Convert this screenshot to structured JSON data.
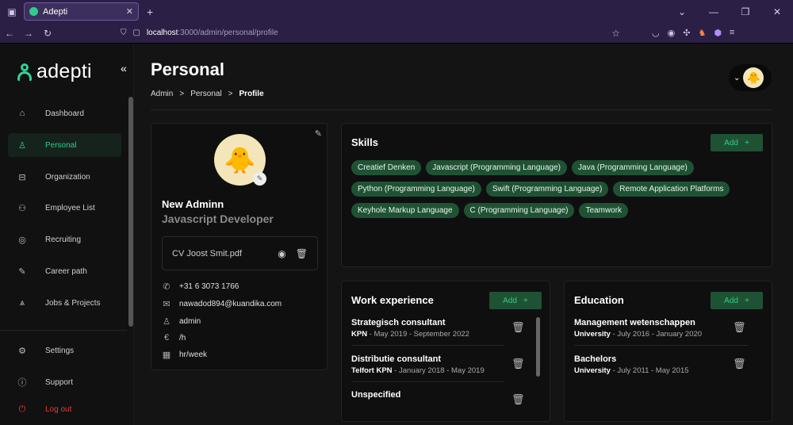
{
  "browser": {
    "tab_title": "Adepti",
    "url_host": "localhost",
    "url_path": ":3000/admin/personal/profile"
  },
  "sidebar": {
    "logo_text": "adepti",
    "items": [
      {
        "label": "Dashboard",
        "icon": "home-icon"
      },
      {
        "label": "Personal",
        "icon": "user-icon"
      },
      {
        "label": "Organization",
        "icon": "briefcase-icon"
      },
      {
        "label": "Employee List",
        "icon": "users-icon"
      },
      {
        "label": "Recruiting",
        "icon": "eye-icon"
      },
      {
        "label": "Career path",
        "icon": "pen-icon"
      },
      {
        "label": "Jobs & Projects",
        "icon": "stack-icon"
      }
    ],
    "bottom_items": [
      {
        "label": "Settings",
        "icon": "gear-icon"
      },
      {
        "label": "Support",
        "icon": "info-icon"
      },
      {
        "label": "Log out",
        "icon": "power-icon"
      }
    ]
  },
  "header": {
    "title": "Personal",
    "breadcrumb": [
      "Admin",
      "Personal",
      "Profile"
    ]
  },
  "profile": {
    "name": "New Adminn",
    "role": "Javascript Developer",
    "cv_file": "CV Joost Smit.pdf",
    "phone": "+31 6 3073 1766",
    "email": "nawadod894@kuandika.com",
    "username": "admin",
    "rate": "/h",
    "hours": "hr/week"
  },
  "skills": {
    "title": "Skills",
    "add_label": "Add",
    "items": [
      "Creatief Denken",
      "Javascript (Programming Language)",
      "Java (Programming Language)",
      "Python (Programming Language)",
      "Swift (Programming Language)",
      "Remote Application Platforms",
      "Keyhole Markup Language",
      "C (Programming Language)",
      "Teamwork"
    ]
  },
  "work": {
    "title": "Work experience",
    "add_label": "Add",
    "items": [
      {
        "title": "Strategisch consultant",
        "org": "KPN",
        "period": "May 2019 - September 2022"
      },
      {
        "title": "Distributie consultant",
        "org": "Telfort KPN",
        "period": "January 2018 - May 2019"
      },
      {
        "title": "Unspecified",
        "org": "",
        "period": ""
      }
    ]
  },
  "education": {
    "title": "Education",
    "add_label": "Add",
    "items": [
      {
        "title": "Management wetenschappen",
        "org": "University",
        "period": "July 2016 - January 2020"
      },
      {
        "title": "Bachelors",
        "org": "University",
        "period": "July 2011 - May 2015"
      }
    ]
  },
  "colors": {
    "accent": "#2ecc8f",
    "chip_bg": "#1f5234",
    "logout": "#e23b3b"
  }
}
